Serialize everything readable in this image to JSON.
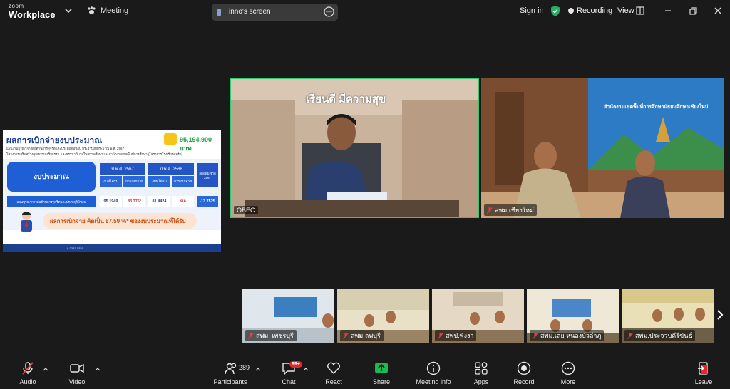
{
  "titlebar": {
    "brand_small": "zoom",
    "brand_big": "Workplace",
    "meeting_label": "Meeting",
    "screen_name": "inno's screen",
    "sign_in": "Sign in",
    "recording": "Recording",
    "view": "View"
  },
  "slide": {
    "title": "ผลการเบิกจ่ายงบประมาณ",
    "amount": "95,194,900 บาท",
    "line1": "แผนงานบูรณาการต่อต้านการทุจริตและประพฤติมิชอบ ประจำปีงบประมาณ พ.ศ. 2567",
    "line2": "โครงการเสริมสร้างคุณธรรม จริยธรรม และธรรมาภิบาลในสถานศึกษาและสำนักงานเขตพื้นที่การศึกษา (โครงการโรงเรียนสุจริต)",
    "budget_label": "งบประมาณ",
    "year1": "ปี พ.ศ. 2567",
    "year2": "ปี พ.ศ. 2568",
    "compare": "ลด/เพิ่ม จาก 2567",
    "sub1": "งบที่ได้รับ",
    "sub2": "การเบิกจ่าย",
    "sub3": "งบที่ได้รับ",
    "sub4": "การเบิกจ่าย",
    "row_label": "แผนบูรณาการต่อต้านการทุจริตและประพฤติมิชอบ",
    "v1": "95.1949",
    "v2": "83.376*",
    "v3": "81.4424",
    "v4": "N/A",
    "v5": "-13.7525",
    "result": "ผลการเบิกจ่าย คิดเป็น 87.59 %* ของงบประมาณที่ได้รับ",
    "footer_phone": "0-2282-1351"
  },
  "tiles": {
    "main_label": "OBEC",
    "b_label": "สพม.เชียงใหม่",
    "banner_main": "เรียนดี มีความสุข",
    "banner_b": "สำนักงานเขตพื้นที่การศึกษามัธยมศึกษาเชียงใหม่"
  },
  "strip": [
    {
      "label": "สพม. เพชรบุรี"
    },
    {
      "label": "สพม.ลพบุรี"
    },
    {
      "label": "สพป.พังงา"
    },
    {
      "label": "สพม.เลย หนองบัวลำภู"
    },
    {
      "label": "สพม.ประจวบคีรีขันธ์"
    }
  ],
  "toolbar": {
    "audio": "Audio",
    "video": "Video",
    "participants": "Participants",
    "participants_count": "289",
    "chat": "Chat",
    "chat_badge": "99+",
    "react": "React",
    "share": "Share",
    "meeting_info": "Meeting info",
    "apps": "Apps",
    "record": "Record",
    "more": "More",
    "leave": "Leave"
  }
}
